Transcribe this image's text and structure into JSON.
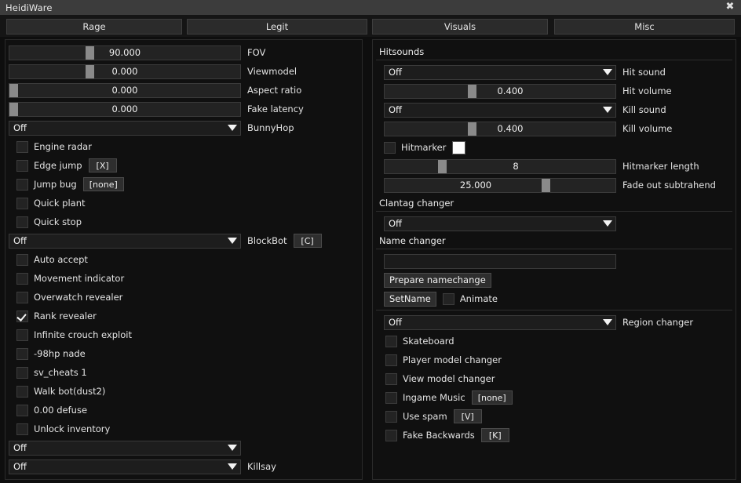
{
  "window": {
    "title": "HeidiWare",
    "close_icon": "close-icon",
    "close_glyph": "✖"
  },
  "tabs": [
    {
      "label": "Rage",
      "active": false
    },
    {
      "label": "Legit",
      "active": false
    },
    {
      "label": "Visuals",
      "active": false
    },
    {
      "label": "Misc",
      "active": true
    }
  ],
  "colors": {
    "window_bg": "#0e0e0e",
    "titlebar": "#3c3c3c",
    "panel_bg": "#101010",
    "panel_border": "#2a2a2a",
    "control_bg": "#232323",
    "control_border": "#3a3a3a",
    "slider_handle": "#8a8a8a",
    "text": "#e4e4e4",
    "hitmarker_swatch": "#ffffff"
  },
  "left_panel": {
    "sliders": [
      {
        "name": "fov",
        "value": "90.000",
        "label": "FOV",
        "handle_pct": 33
      },
      {
        "name": "viewmodel",
        "value": "0.000",
        "label": "Viewmodel",
        "handle_pct": 33
      },
      {
        "name": "aspect-ratio",
        "value": "0.000",
        "label": "Aspect ratio",
        "handle_pct": 0
      },
      {
        "name": "fake-latency",
        "value": "0.000",
        "label": "Fake latency",
        "handle_pct": 0
      }
    ],
    "bunnyhop": {
      "value": "Off",
      "label": "BunnyHop"
    },
    "checks_a": [
      {
        "label": "Engine radar",
        "checked": false,
        "key": null
      },
      {
        "label": "Edge jump",
        "checked": false,
        "key": "[X]"
      },
      {
        "label": "Jump bug",
        "checked": false,
        "key": "[none]"
      },
      {
        "label": "Quick plant",
        "checked": false,
        "key": null
      },
      {
        "label": "Quick stop",
        "checked": false,
        "key": null
      }
    ],
    "blockbot": {
      "value": "Off",
      "label": "BlockBot",
      "key": "[C]"
    },
    "checks_b": [
      {
        "label": "Auto accept",
        "checked": false
      },
      {
        "label": "Movement indicator",
        "checked": false
      },
      {
        "label": "Overwatch revealer",
        "checked": false
      },
      {
        "label": "Rank revealer",
        "checked": true
      },
      {
        "label": "Infinite crouch exploit",
        "checked": false
      },
      {
        "label": "-98hp nade",
        "checked": false
      },
      {
        "label": "sv_cheats 1",
        "checked": false
      },
      {
        "label": "Walk bot(dust2)",
        "checked": false
      },
      {
        "label": "0.00 defuse",
        "checked": false
      },
      {
        "label": "Unlock inventory",
        "checked": false
      }
    ],
    "dropdowns_bottom": [
      {
        "value": "Off",
        "label": ""
      },
      {
        "value": "Off",
        "label": "Killsay"
      }
    ]
  },
  "right_panel": {
    "hitsounds_header": "Hitsounds",
    "hit_sound": {
      "value": "Off",
      "label": "Hit sound"
    },
    "hit_volume": {
      "value": "0.400",
      "label": "Hit volume",
      "handle_pct": 36
    },
    "kill_sound": {
      "value": "Off",
      "label": "Kill sound"
    },
    "kill_volume": {
      "value": "0.400",
      "label": "Kill volume",
      "handle_pct": 36
    },
    "hitmarker": {
      "label": "Hitmarker",
      "checked": false,
      "swatch_color": "#ffffff"
    },
    "hitmarker_length": {
      "value": "8",
      "label": "Hitmarker length",
      "handle_pct": 23
    },
    "fade_out_subtrahend": {
      "value": "25.000",
      "label": "Fade out subtrahend",
      "handle_pct": 68
    },
    "clantag_header": "Clantag changer",
    "clantag": {
      "value": "Off"
    },
    "name_changer_header": "Name changer",
    "name_input": {
      "value": "",
      "placeholder": ""
    },
    "prepare_namechange": "Prepare namechange",
    "setname": "SetName",
    "animate": {
      "label": "Animate",
      "checked": false
    },
    "region_changer": {
      "value": "Off",
      "label": "Region changer"
    },
    "checks": [
      {
        "label": "Skateboard",
        "checked": false,
        "key": null
      },
      {
        "label": "Player model changer",
        "checked": false,
        "key": null
      },
      {
        "label": "View model changer",
        "checked": false,
        "key": null
      },
      {
        "label": "Ingame Music",
        "checked": false,
        "key": "[none]"
      },
      {
        "label": "Use spam",
        "checked": false,
        "key": "[V]"
      },
      {
        "label": "Fake Backwards",
        "checked": false,
        "key": "[K]"
      }
    ]
  }
}
